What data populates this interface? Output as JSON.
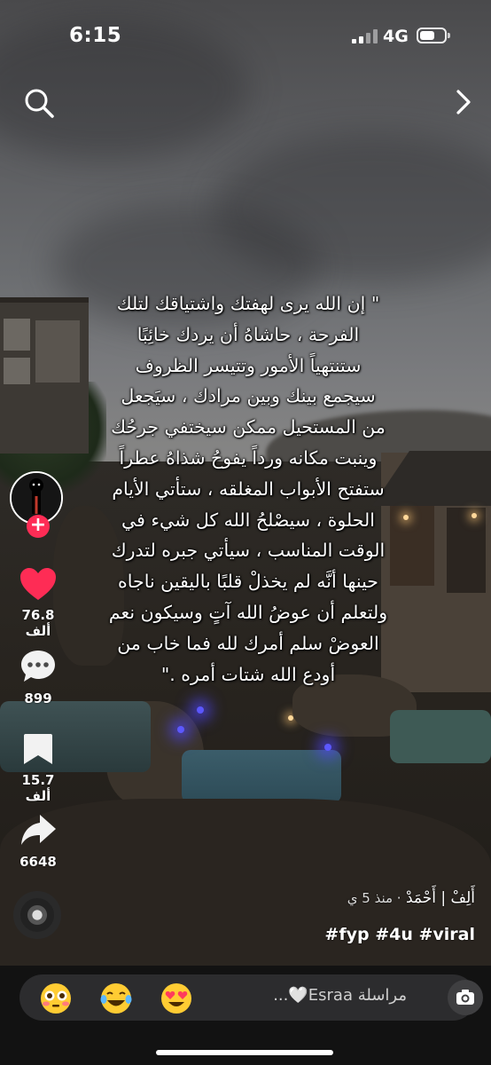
{
  "status_bar": {
    "time": "6:15",
    "network": "4G"
  },
  "caption": {
    "text": "\" إن الله يرى لهفتك واشتياقك لتلك\nالفرحة ، حاشاهُ أن يردك خائِبًا\nستنتهياً الأمور وتتيسر الظروف\nسيجمع بينك وبين مرادك ، سيَجعل\nمن المستحيل ممكن سيختفي جرحُك\nوينبت مكانه ورداً يفوحُ شذاهُ عطراً\nستفتح الأبواب المغلقه ، ستأتي الأيام\nالحلوة ، سيصْلحُ الله كل شيء في\nالوقت المناسب ، سيأتي جبره لتدرك\nحينها أنَّه لم يخذلْ قلبًا باليقين ناجاه\nولتعلم أن عوضُ الله آتٍ وسيكون نعم\nالعوضْ سلم أمرك لله فما خاب من\nأودع الله شتات أمره .\""
  },
  "actions": {
    "likes": "76.8 ألف",
    "comments": "899",
    "saves": "15.7 ألف",
    "shares": "6648",
    "follow_symbol": "+"
  },
  "post": {
    "author": "أَلِفْ | أَحْمَدْ",
    "meta": "· منذ 5 ي",
    "hashtags": "#fyp #4u #viral"
  },
  "comment_bar": {
    "placeholder": "مراسلة Esraa🤍..."
  },
  "icons": {
    "search": "search-icon",
    "next": "chevron-right-icon",
    "like": "heart-icon",
    "comment": "comment-bubble-icon",
    "save": "bookmark-icon",
    "share": "share-arrow-icon",
    "camera": "camera-icon",
    "emoji_1": "flushed-face-emoji",
    "emoji_2": "tears-of-joy-emoji",
    "emoji_3": "heart-eyes-emoji"
  },
  "colors": {
    "like": "#fe2c55",
    "follow": "#fe2c55",
    "bar": "#121212"
  }
}
